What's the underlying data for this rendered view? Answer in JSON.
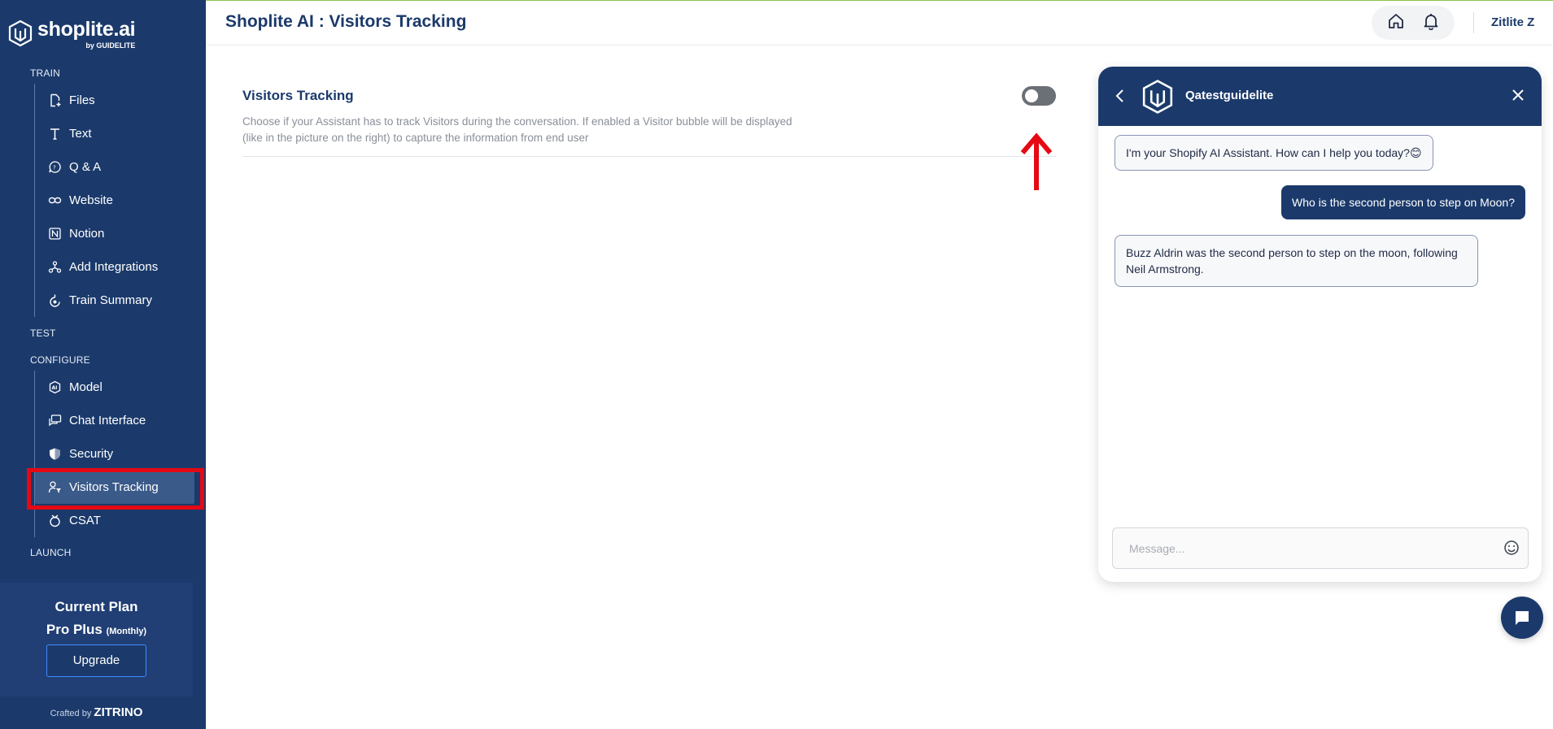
{
  "brand": {
    "name": "shoplite.ai",
    "sub": "by GUIDELITE"
  },
  "sidebar": {
    "sections": {
      "train": "TRAIN",
      "test": "TEST",
      "configure": "CONFIGURE",
      "launch": "LAUNCH"
    },
    "train_items": [
      {
        "label": "Files",
        "icon": "file-add-icon"
      },
      {
        "label": "Text",
        "icon": "text-icon"
      },
      {
        "label": "Q & A",
        "icon": "qa-bubble-icon"
      },
      {
        "label": "Website",
        "icon": "link-icon"
      },
      {
        "label": "Notion",
        "icon": "notion-icon"
      },
      {
        "label": "Add Integrations",
        "icon": "integrations-icon"
      },
      {
        "label": "Train Summary",
        "icon": "summary-icon"
      }
    ],
    "configure_items": [
      {
        "label": "Model",
        "icon": "ai-model-icon"
      },
      {
        "label": "Chat Interface",
        "icon": "chat-interface-icon"
      },
      {
        "label": "Security",
        "icon": "shield-icon"
      },
      {
        "label": "Visitors Tracking",
        "icon": "user-filter-icon",
        "active": true
      },
      {
        "label": "CSAT",
        "icon": "csat-icon"
      }
    ],
    "plan": {
      "title": "Current Plan",
      "name": "Pro Plus",
      "period": "(Monthly)",
      "upgrade_label": "Upgrade"
    },
    "crafted_prefix": "Crafted by",
    "crafted_brand": "ZITRINO"
  },
  "header": {
    "title": "Shoplite AI : Visitors Tracking",
    "user_name": "Zitlite Z",
    "avatar_initial": "Z"
  },
  "setting": {
    "title": "Visitors Tracking",
    "description": "Choose if your Assistant has to track Visitors during the conversation. If enabled a Visitor bubble will be displayed (like in the picture on the right) to capture the information from end user",
    "enabled": false
  },
  "chat": {
    "bot_name": "Qatestguidelite",
    "messages": [
      {
        "from": "bot",
        "text": "I'm your Shopify AI Assistant. How can I help you today?😊"
      },
      {
        "from": "user",
        "text": "Who is the second person to step on Moon?"
      },
      {
        "from": "bot",
        "text": "Buzz Aldrin was the second person to step on the moon, following Neil Armstrong."
      }
    ],
    "input_placeholder": "Message..."
  },
  "colors": {
    "sidebar": "#1b3a6b",
    "highlight": "#e50914",
    "arrow": "#e50914"
  }
}
